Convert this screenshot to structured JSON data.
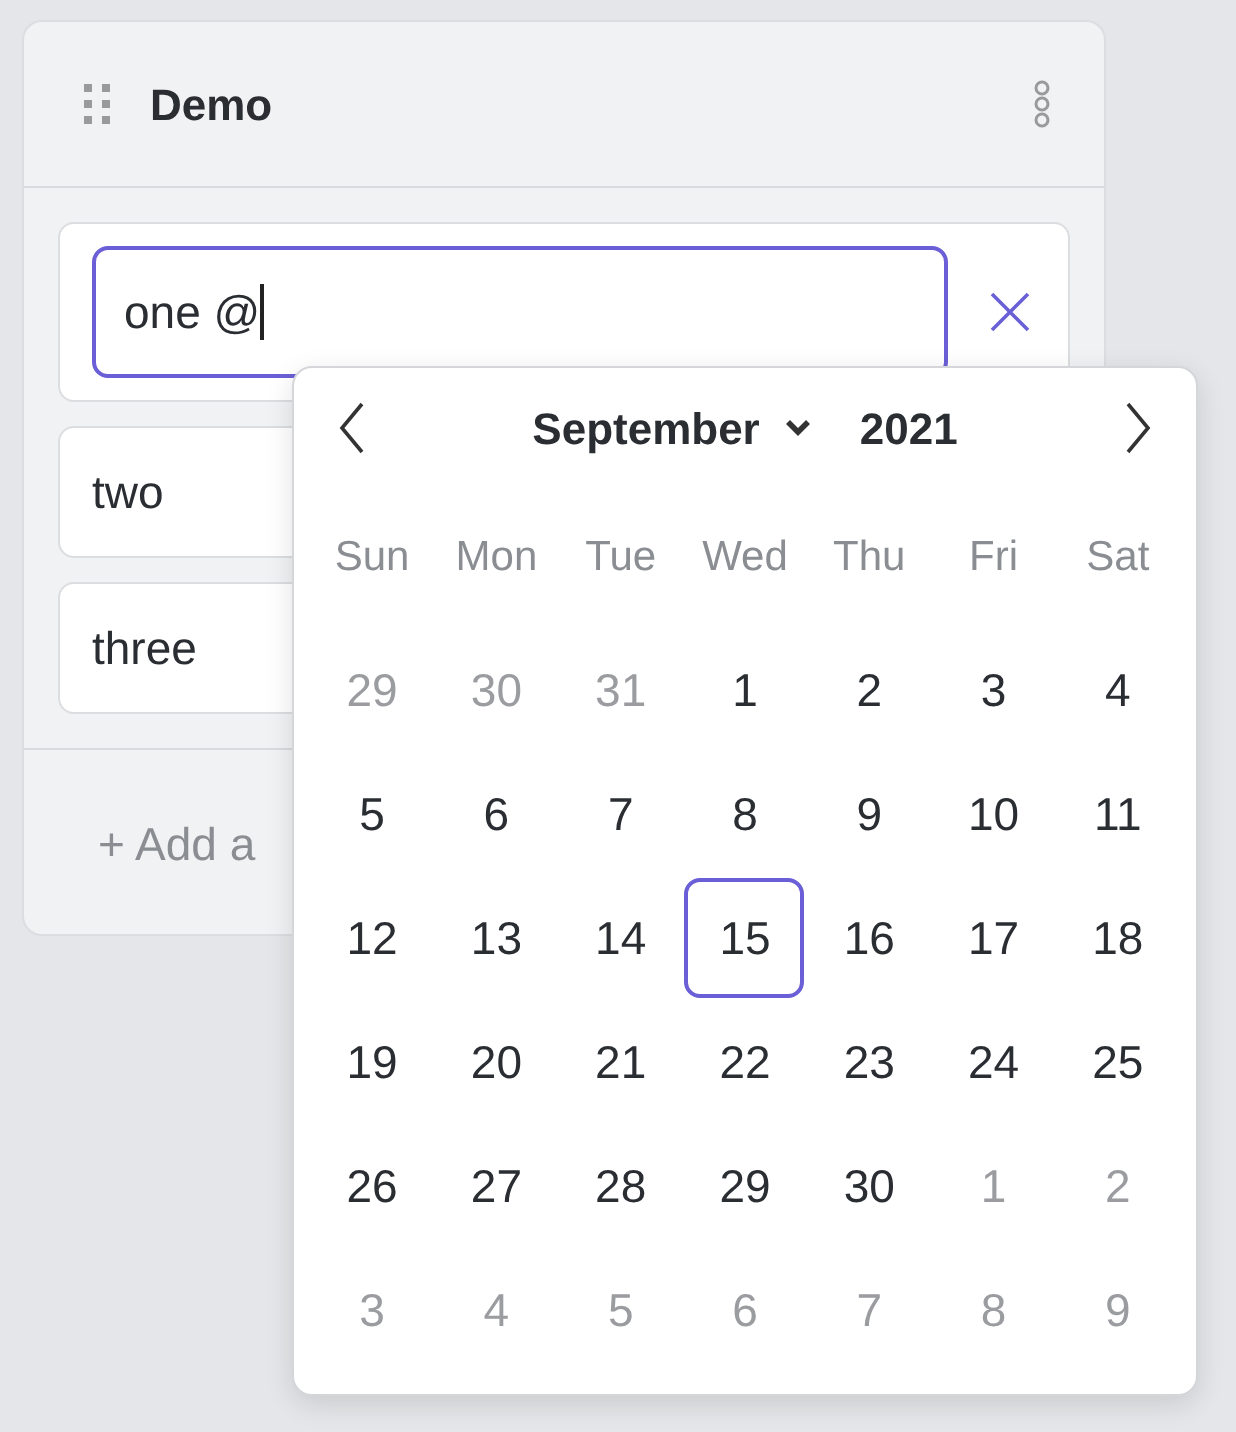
{
  "panel": {
    "title": "Demo"
  },
  "items": [
    {
      "value": "one @",
      "focused": true
    },
    {
      "value": "two",
      "focused": false
    },
    {
      "value": "three",
      "focused": false
    }
  ],
  "add_link": "+ Add a",
  "calendar": {
    "month": "September",
    "year": "2021",
    "weekdays": [
      "Sun",
      "Mon",
      "Tue",
      "Wed",
      "Thu",
      "Fri",
      "Sat"
    ],
    "weeks": [
      [
        {
          "day": "29",
          "outside": true,
          "selected": false
        },
        {
          "day": "30",
          "outside": true,
          "selected": false
        },
        {
          "day": "31",
          "outside": true,
          "selected": false
        },
        {
          "day": "1",
          "outside": false,
          "selected": false
        },
        {
          "day": "2",
          "outside": false,
          "selected": false
        },
        {
          "day": "3",
          "outside": false,
          "selected": false
        },
        {
          "day": "4",
          "outside": false,
          "selected": false
        }
      ],
      [
        {
          "day": "5",
          "outside": false,
          "selected": false
        },
        {
          "day": "6",
          "outside": false,
          "selected": false
        },
        {
          "day": "7",
          "outside": false,
          "selected": false
        },
        {
          "day": "8",
          "outside": false,
          "selected": false
        },
        {
          "day": "9",
          "outside": false,
          "selected": false
        },
        {
          "day": "10",
          "outside": false,
          "selected": false
        },
        {
          "day": "11",
          "outside": false,
          "selected": false
        }
      ],
      [
        {
          "day": "12",
          "outside": false,
          "selected": false
        },
        {
          "day": "13",
          "outside": false,
          "selected": false
        },
        {
          "day": "14",
          "outside": false,
          "selected": false
        },
        {
          "day": "15",
          "outside": false,
          "selected": true
        },
        {
          "day": "16",
          "outside": false,
          "selected": false
        },
        {
          "day": "17",
          "outside": false,
          "selected": false
        },
        {
          "day": "18",
          "outside": false,
          "selected": false
        }
      ],
      [
        {
          "day": "19",
          "outside": false,
          "selected": false
        },
        {
          "day": "20",
          "outside": false,
          "selected": false
        },
        {
          "day": "21",
          "outside": false,
          "selected": false
        },
        {
          "day": "22",
          "outside": false,
          "selected": false
        },
        {
          "day": "23",
          "outside": false,
          "selected": false
        },
        {
          "day": "24",
          "outside": false,
          "selected": false
        },
        {
          "day": "25",
          "outside": false,
          "selected": false
        }
      ],
      [
        {
          "day": "26",
          "outside": false,
          "selected": false
        },
        {
          "day": "27",
          "outside": false,
          "selected": false
        },
        {
          "day": "28",
          "outside": false,
          "selected": false
        },
        {
          "day": "29",
          "outside": false,
          "selected": false
        },
        {
          "day": "30",
          "outside": false,
          "selected": false
        },
        {
          "day": "1",
          "outside": true,
          "selected": false
        },
        {
          "day": "2",
          "outside": true,
          "selected": false
        }
      ],
      [
        {
          "day": "3",
          "outside": true,
          "selected": false
        },
        {
          "day": "4",
          "outside": true,
          "selected": false
        },
        {
          "day": "5",
          "outside": true,
          "selected": false
        },
        {
          "day": "6",
          "outside": true,
          "selected": false
        },
        {
          "day": "7",
          "outside": true,
          "selected": false
        },
        {
          "day": "8",
          "outside": true,
          "selected": false
        },
        {
          "day": "9",
          "outside": true,
          "selected": false
        }
      ]
    ]
  }
}
